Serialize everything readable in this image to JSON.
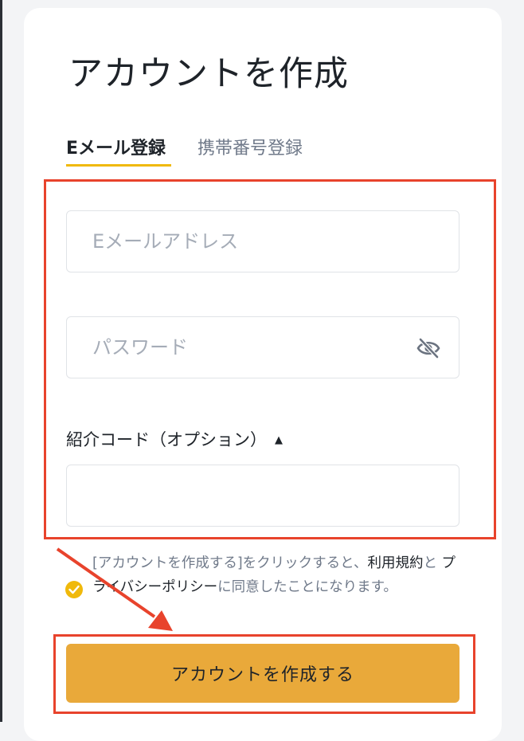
{
  "page": {
    "title": "アカウントを作成"
  },
  "tabs": {
    "email_label": "Eメール登録",
    "phone_label": "携帯番号登録"
  },
  "form": {
    "email_placeholder": "Eメールアドレス",
    "password_placeholder": "パスワード",
    "referral_label": "紹介コード（オプション）",
    "referral_toggle_icon": "▲",
    "referral_value": ""
  },
  "consent": {
    "prefix": "[アカウントを作成する]をクリックすると、",
    "terms_link": "利用規約",
    "connector": "と",
    "privacy_link": "プライバシーポリシー",
    "suffix": "に同意したことになります。",
    "checked": true
  },
  "submit": {
    "label": "アカウントを作成する"
  },
  "colors": {
    "accent": "#f0b90b",
    "button": "#e9a93a",
    "annotation_red": "#e8432c",
    "text_primary": "#1e2329",
    "text_secondary": "#707a8a"
  },
  "icons": {
    "password_visibility": "eye-slash-icon",
    "consent_check": "check-circle-icon"
  }
}
